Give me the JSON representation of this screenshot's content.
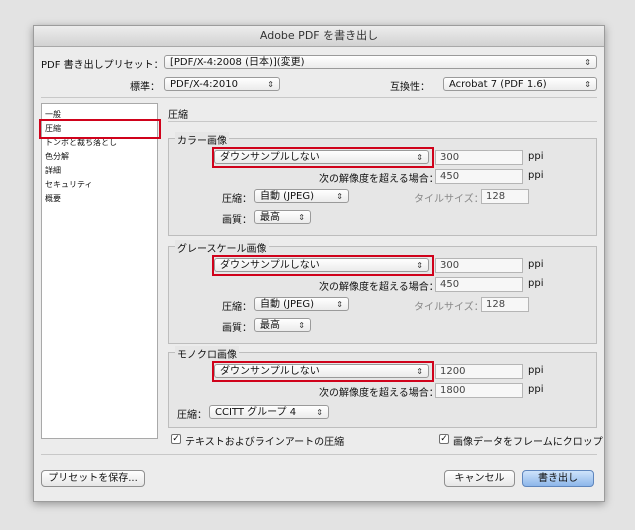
{
  "window_title": "Adobe PDF を書き出し",
  "preset": {
    "label": "PDF 書き出しプリセット：",
    "value": "[PDF/X-4:2008 (日本)](変更)"
  },
  "standard": {
    "label": "標準：",
    "value": "PDF/X-4:2010"
  },
  "compat": {
    "label": "互換性：",
    "value": "Acrobat 7 (PDF 1.6)"
  },
  "sidebar": {
    "items": [
      {
        "label": "一般"
      },
      {
        "label": "圧縮"
      },
      {
        "label": "トンボと裁ち落とし"
      },
      {
        "label": "色分解"
      },
      {
        "label": "詳細"
      },
      {
        "label": "セキュリティ"
      },
      {
        "label": "概要"
      }
    ],
    "selected_index": 1
  },
  "panel_title": "圧縮",
  "color": {
    "title": "カラー画像",
    "downsample": "ダウンサンプルしない",
    "ppi_value": "300",
    "ppi_unit": "ppi",
    "above_label": "次の解像度を超える場合：",
    "above_value": "450",
    "above_unit": "ppi",
    "comp_label": "圧縮：",
    "comp_value": "自動 (JPEG)",
    "tile_label": "タイルサイズ：",
    "tile_value": "128",
    "quality_label": "画質：",
    "quality_value": "最高"
  },
  "gray": {
    "title": "グレースケール画像",
    "downsample": "ダウンサンプルしない",
    "ppi_value": "300",
    "ppi_unit": "ppi",
    "above_label": "次の解像度を超える場合：",
    "above_value": "450",
    "above_unit": "ppi",
    "comp_label": "圧縮：",
    "comp_value": "自動 (JPEG)",
    "tile_label": "タイルサイズ：",
    "tile_value": "128",
    "quality_label": "画質：",
    "quality_value": "最高"
  },
  "mono": {
    "title": "モノクロ画像",
    "downsample": "ダウンサンプルしない",
    "ppi_value": "1200",
    "ppi_unit": "ppi",
    "above_label": "次の解像度を超える場合：",
    "above_value": "1800",
    "above_unit": "ppi",
    "comp_label": "圧縮：",
    "comp_value": "CCITT グループ 4"
  },
  "checks": {
    "text_art": {
      "label": "テキストおよびラインアートの圧縮",
      "checked": true
    },
    "crop": {
      "label": "画像データをフレームにクロップ",
      "checked": true
    }
  },
  "buttons": {
    "save_preset": "プリセットを保存...",
    "cancel": "キャンセル",
    "export": "書き出し"
  },
  "icons": {
    "popup_arrow": "⌃⌄",
    "check": "✓",
    "stepper": "⇕"
  },
  "highlight_color": "#d0021b"
}
